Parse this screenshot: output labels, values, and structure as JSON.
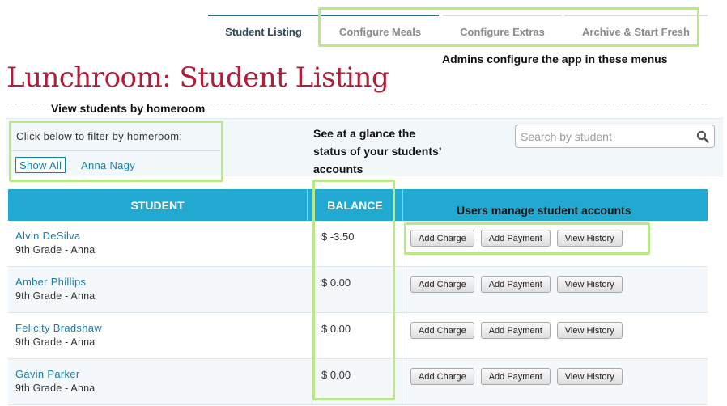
{
  "nav": {
    "tabs": [
      {
        "label": "Student Listing",
        "active": true
      },
      {
        "label": "Configure Meals",
        "active": false
      },
      {
        "label": "Configure Extras",
        "active": false
      },
      {
        "label": "Archive & Start Fresh",
        "active": false
      }
    ]
  },
  "page": {
    "title": "Lunchroom: Student Listing"
  },
  "filter": {
    "prompt": "Click below to filter by homeroom:",
    "options": [
      "Show All",
      "Anna Nagy"
    ],
    "selected": "Show All"
  },
  "search": {
    "placeholder": "Search by student",
    "value": ""
  },
  "table": {
    "headers": [
      "STUDENT",
      "BALANCE",
      ""
    ],
    "rows": [
      {
        "name": "Alvin DeSilva",
        "grade": "9th Grade - Anna",
        "balance": "$ -3.50"
      },
      {
        "name": "Amber Phillips",
        "grade": "9th Grade - Anna",
        "balance": "$ 0.00"
      },
      {
        "name": "Felicity Bradshaw",
        "grade": "9th Grade - Anna",
        "balance": "$ 0.00"
      },
      {
        "name": "Gavin Parker",
        "grade": "9th Grade - Anna",
        "balance": "$ 0.00"
      }
    ],
    "actions": [
      "Add Charge",
      "Add Payment",
      "View History"
    ]
  },
  "annotations": {
    "menus": "Admins configure the app in these menus",
    "homeroom": "View students by homeroom",
    "balance_line1": "See at a glance the",
    "balance_line2": "status of your students’",
    "balance_line3": "accounts",
    "manage": "Users manage student accounts"
  },
  "colors": {
    "accent": "#21a9d2",
    "title": "#b01e3a",
    "link": "#1a7ea4",
    "highlight": "#b8e986"
  }
}
